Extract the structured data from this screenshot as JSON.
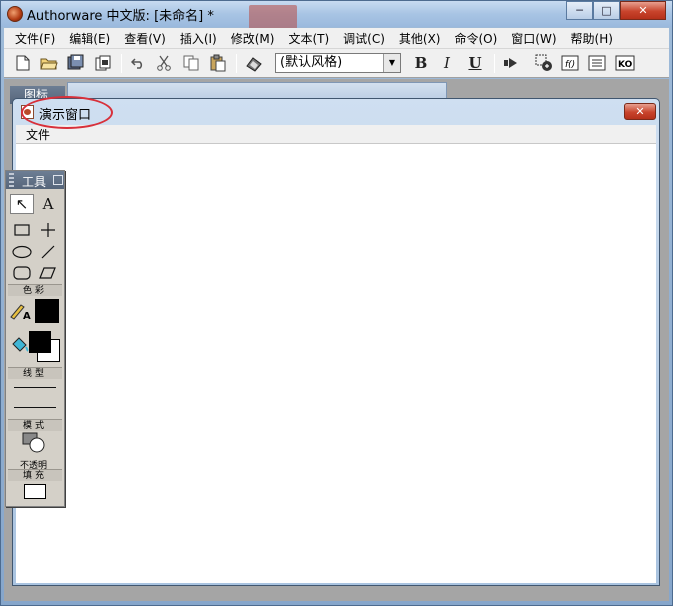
{
  "app": {
    "title": "Authorware 中文版: [未命名] *",
    "caption_buttons": {
      "minimize": "─",
      "maximize": "□",
      "close": "✕"
    }
  },
  "menu": {
    "items": [
      "文件(F)",
      "编辑(E)",
      "查看(V)",
      "插入(I)",
      "修改(M)",
      "文本(T)",
      "调试(C)",
      "其他(X)",
      "命令(O)",
      "窗口(W)",
      "帮助(H)"
    ]
  },
  "toolbar": {
    "style_select": "(默认风格)",
    "bold_label": "B",
    "italic_label": "I",
    "underline_label": "U",
    "icons": [
      "new-icon",
      "open-icon",
      "save-all-icon",
      "import-icon",
      "undo-icon",
      "cut-icon",
      "copy-icon",
      "paste-icon",
      "find-icon",
      "bold-icon",
      "italic-icon",
      "underline-icon",
      "run-icon",
      "control-panel-icon",
      "functions-icon",
      "variables-icon",
      "knowledge-objects-icon"
    ]
  },
  "icon_palette": {
    "title": "图标"
  },
  "presentation_window": {
    "title": "演示窗口",
    "menu_file": "文件",
    "close_label": "✕"
  },
  "tools": {
    "title": "工具",
    "close_label": "⊠",
    "pointer_glyph": "↖",
    "text_glyph": "A",
    "color_label": "色彩",
    "line_label": "线型",
    "mode_label": "模式",
    "mode_value": "不透明",
    "fill_label": "填充"
  },
  "colors": {
    "highlight": "#d8303a",
    "foreground": "#000000",
    "background": "#ffffff"
  }
}
